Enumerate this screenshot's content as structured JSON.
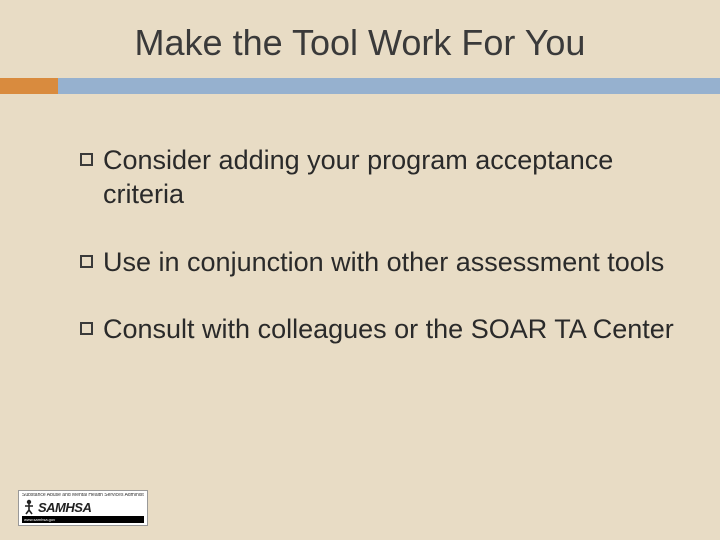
{
  "title": "Make the Tool Work For You",
  "bullets": [
    {
      "text": "Consider adding your program acceptance criteria"
    },
    {
      "text": "Use in conjunction with other assessment tools"
    },
    {
      "text": "Consult with colleagues or the SOAR TA Center"
    }
  ],
  "logo": {
    "top": "Substance Abuse and Mental Health Services Administration",
    "name": "SAMHSA",
    "bottom": "www.samhsa.gov"
  }
}
